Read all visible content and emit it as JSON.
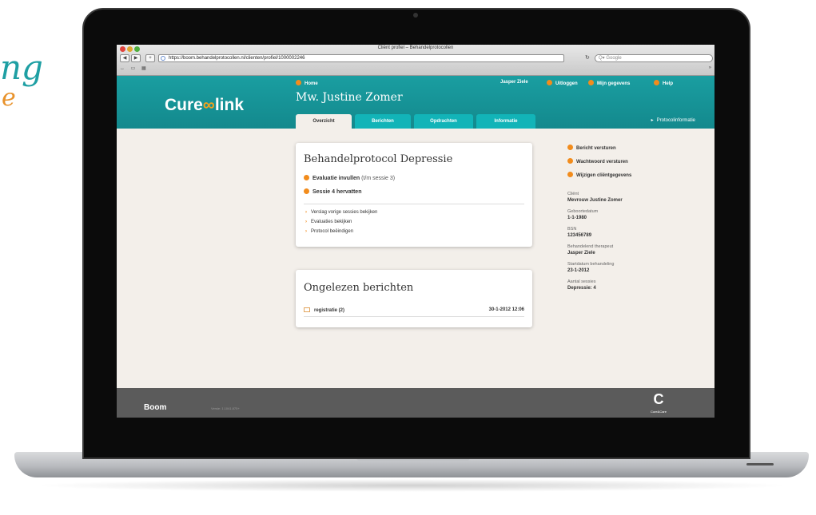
{
  "decor": {
    "line1": "ng",
    "line2": "e"
  },
  "browser": {
    "title": "Cliënt profiel – Behandelprotocollen",
    "url": "https://boom.behandelprotocollen.nl/clienten/profiel/1000002246",
    "search_placeholder": "Q▾ Google"
  },
  "site": {
    "logo_left": "Cure",
    "logo_mark": "∞",
    "logo_right": "link",
    "home_link": "Home",
    "user_name": "Jasper Ziele",
    "logout_link": "Uitloggen",
    "my_data_link": "Mijn gegevens",
    "help_link": "Help",
    "patient_name": "Mw. Justine Zomer",
    "tabs": [
      {
        "label": "Overzicht"
      },
      {
        "label": "Berichten"
      },
      {
        "label": "Opdrachten"
      },
      {
        "label": "Informatie"
      }
    ],
    "protocol_info_link": "Protocolinformatie"
  },
  "protocol_card": {
    "title": "Behandelprotocol Depressie",
    "action1_label": "Evaluatie invullen",
    "action1_note": "(t/m sessie 3)",
    "action2_label": "Sessie 4 hervatten",
    "links": [
      "Verslag vorige sessies bekijken",
      "Evaluaties bekijken",
      "Protocol beëindigen"
    ]
  },
  "messages_card": {
    "title": "Ongelezen berichten",
    "row_label": "registratie (2)",
    "row_date": "30-1-2012 12:06"
  },
  "side_panel": {
    "actions": [
      "Bericht versturen",
      "Wachtwoord versturen",
      "Wijzigen cliëntgegevens"
    ],
    "client_label": "Cliënt",
    "client_value": "Mevrouw Justine Zomer",
    "dob_label": "Geboortedatum",
    "dob_value": "1-1-1980",
    "bsn_label": "BSN",
    "bsn_value": "123456789",
    "therapist_label": "Behandelend therapeut",
    "therapist_value": "Jasper Ziele",
    "start_label": "Startdatum behandeling",
    "start_value": "23-1-2012",
    "sessions_label": "Aantal sessies",
    "sessions_value": "Depressie: 4"
  },
  "footer": {
    "brand": "Boom",
    "version": "Versie: 1.1041.875+",
    "partner_mark": "C",
    "partner_name": "Cure&Care"
  },
  "colors": {
    "teal": "#1a9ea1",
    "tab": "#12b4b8",
    "accent_orange": "#f28c1c",
    "page_bg": "#f3efea",
    "footer": "#5b5b5b"
  }
}
